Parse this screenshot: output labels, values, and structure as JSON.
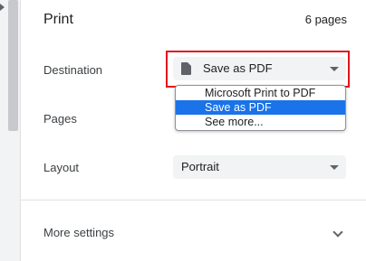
{
  "header": {
    "title": "Print",
    "page_count": "6 pages"
  },
  "destination": {
    "label": "Destination",
    "value": "Save as PDF",
    "icon": "document-icon",
    "options": [
      {
        "label": "Microsoft Print to PDF",
        "selected": false
      },
      {
        "label": "Save as PDF",
        "selected": true
      },
      {
        "label": "See more...",
        "selected": false
      }
    ]
  },
  "pages": {
    "label": "Pages"
  },
  "layout": {
    "label": "Layout",
    "value": "Portrait"
  },
  "more_settings": {
    "label": "More settings"
  },
  "colors": {
    "highlight": "#e3141b",
    "selected_option": "#1a73e8",
    "select_bg": "#f1f3f4"
  }
}
